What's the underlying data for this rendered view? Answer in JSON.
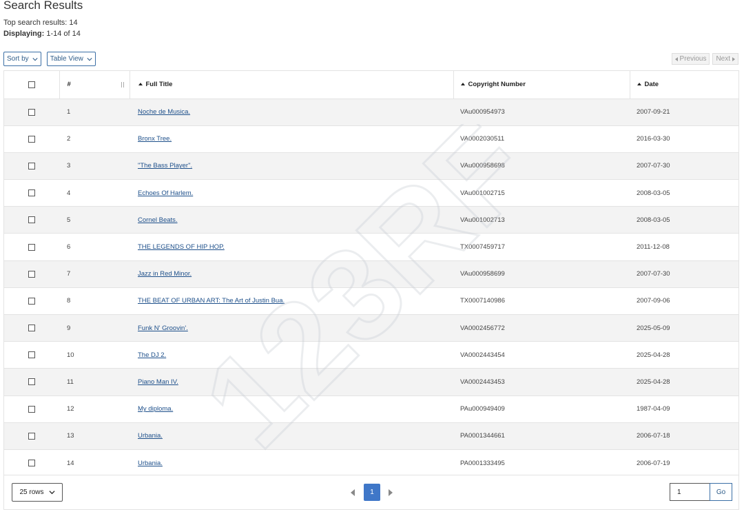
{
  "header": {
    "title": "Search Results",
    "top_results_label": "Top search results: 14",
    "displaying_label": "Displaying:",
    "displaying_value": "1-14 of 14"
  },
  "toolbar": {
    "sort_label": "Sort by",
    "view_label": "Table View"
  },
  "pager_top": {
    "previous_label": "Previous",
    "next_label": "Next"
  },
  "table": {
    "columns": {
      "number": "#",
      "full_title": "Full Title",
      "copyright_number": "Copyright Number",
      "date": "Date"
    },
    "rows": [
      {
        "n": "1",
        "title": "Noche de Musica.",
        "copyright": "VAu000954973",
        "date": "2007-09-21"
      },
      {
        "n": "2",
        "title": "Bronx Tree.",
        "copyright": "VA0002030511",
        "date": "2016-03-30"
      },
      {
        "n": "3",
        "title": "\"The Bass Player\".",
        "copyright": "VAu000958698",
        "date": "2007-07-30"
      },
      {
        "n": "4",
        "title": "Echoes Of Harlem.",
        "copyright": "VAu001002715",
        "date": "2008-03-05"
      },
      {
        "n": "5",
        "title": "Cornel Beats.",
        "copyright": "VAu001002713",
        "date": "2008-03-05"
      },
      {
        "n": "6",
        "title": "THE LEGENDS OF HIP HOP.",
        "copyright": "TX0007459717",
        "date": "2011-12-08"
      },
      {
        "n": "7",
        "title": "Jazz in Red Minor.",
        "copyright": "VAu000958699",
        "date": "2007-07-30"
      },
      {
        "n": "8",
        "title": "THE BEAT OF URBAN ART: The Art of Justin Bua.",
        "copyright": "TX0007140986",
        "date": "2007-09-06"
      },
      {
        "n": "9",
        "title": "Funk N' Groovin'.",
        "copyright": "VA0002456772",
        "date": "2025-05-09"
      },
      {
        "n": "10",
        "title": "The DJ 2.",
        "copyright": "VA0002443454",
        "date": "2025-04-28"
      },
      {
        "n": "11",
        "title": "Piano Man IV.",
        "copyright": "VA0002443453",
        "date": "2025-04-28"
      },
      {
        "n": "12",
        "title": "My diploma.",
        "copyright": "PAu000949409",
        "date": "1987-04-09"
      },
      {
        "n": "13",
        "title": "Urbania.",
        "copyright": "PA0001344661",
        "date": "2006-07-18"
      },
      {
        "n": "14",
        "title": "Urbania.",
        "copyright": "PA0001333495",
        "date": "2006-07-19"
      }
    ]
  },
  "footer": {
    "rows_label": "25 rows",
    "current_page": "1",
    "page_input_value": "1",
    "go_label": "Go"
  },
  "watermark": {
    "text": "123RF"
  },
  "colors": {
    "accent": "#3f77c8",
    "link": "#1d4f8a",
    "stripe": "#f3f3f3"
  }
}
